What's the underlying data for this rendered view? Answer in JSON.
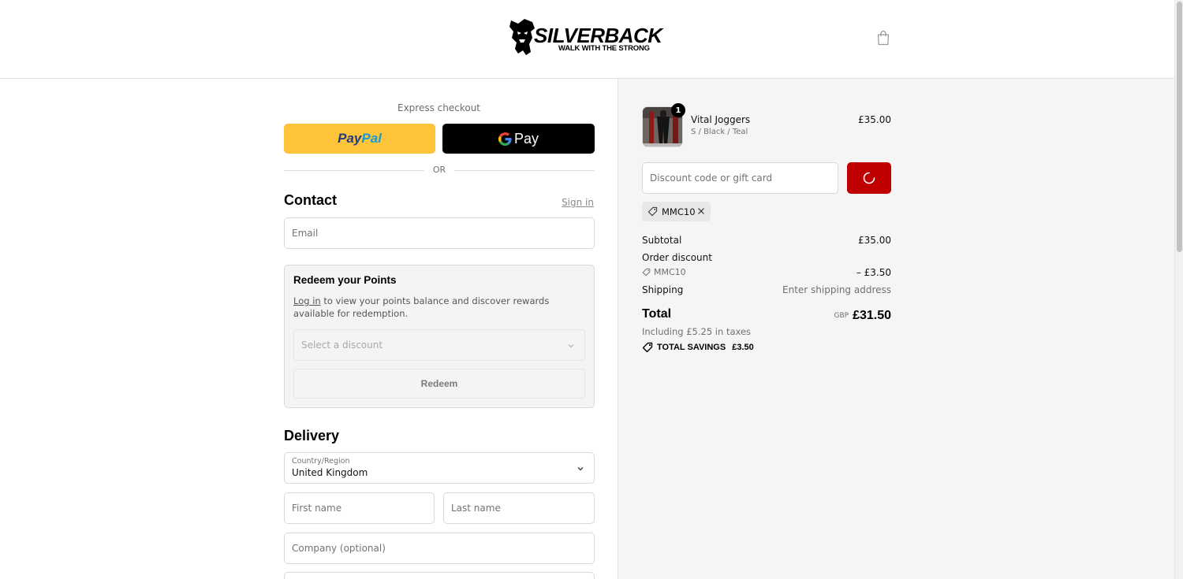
{
  "brand": {
    "name": "SILVERBACK",
    "tagline": "WALK WITH THE STRONG",
    "accent": "#c00000"
  },
  "express": {
    "title": "Express checkout",
    "paypal_label_1": "Pay",
    "paypal_label_2": "Pal",
    "gpay_label": "Pay",
    "or": "OR"
  },
  "contact": {
    "heading": "Contact",
    "signin": "Sign in",
    "email_placeholder": "Email"
  },
  "points": {
    "heading": "Redeem your Points",
    "login_link": "Log in",
    "desc_rest": " to view your points balance and discover rewards available for redemption.",
    "select_placeholder": "Select a discount",
    "redeem_label": "Redeem"
  },
  "delivery": {
    "heading": "Delivery",
    "country_label": "Country/Region",
    "country_value": "United Kingdom",
    "first_name_placeholder": "First name",
    "last_name_placeholder": "Last name",
    "company_placeholder": "Company (optional)"
  },
  "cart": {
    "item": {
      "name": "Vital Joggers",
      "variant": "S / Black / Teal",
      "price": "£35.00",
      "quantity": "1"
    },
    "discount_placeholder": "Discount code or gift card",
    "applied_code": "MMC10"
  },
  "summary": {
    "subtotal_label": "Subtotal",
    "subtotal_value": "£35.00",
    "order_discount_label": "Order discount",
    "discount_code": "MMC10",
    "discount_value": "– £3.50",
    "shipping_label": "Shipping",
    "shipping_value": "Enter shipping address",
    "total_label": "Total",
    "currency": "GBP",
    "total_value": "£31.50",
    "tax_line": "Including £5.25 in taxes",
    "savings_label": "TOTAL SAVINGS",
    "savings_value": "£3.50"
  }
}
